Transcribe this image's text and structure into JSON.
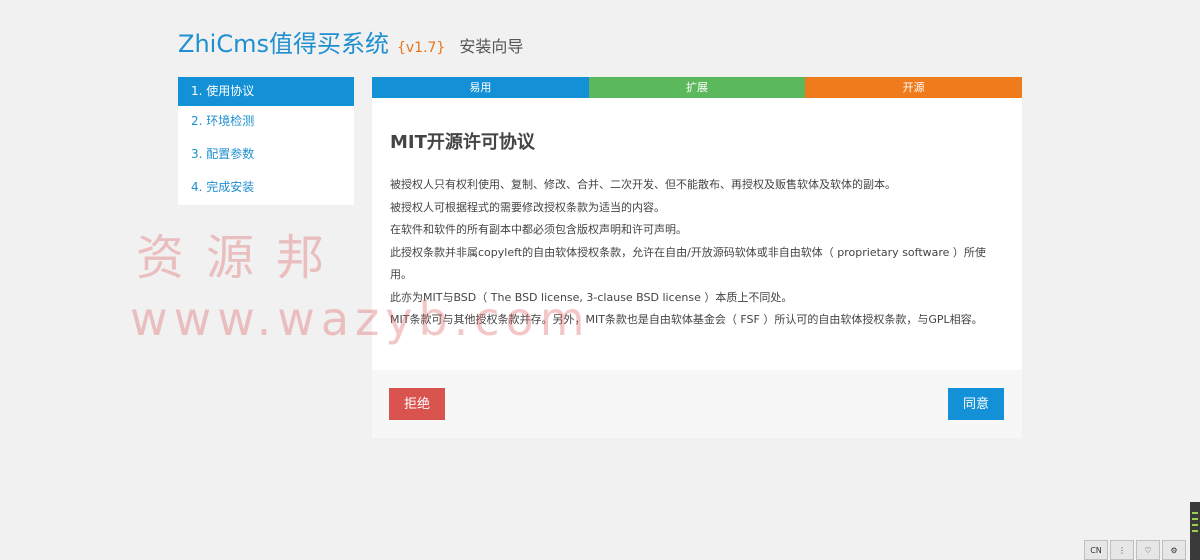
{
  "header": {
    "brand": "ZhiCms值得买系统",
    "version": "{v1.7}",
    "subtitle": "安装向导"
  },
  "sidebar": {
    "items": [
      {
        "label": "1. 使用协议",
        "active": true
      },
      {
        "label": "2. 环境检测",
        "active": false
      },
      {
        "label": "3. 配置参数",
        "active": false
      },
      {
        "label": "4. 完成安装",
        "active": false
      }
    ]
  },
  "strip": {
    "labels": [
      "易用",
      "扩展",
      "开源"
    ],
    "colors": [
      "#1490d6",
      "#5cb85c",
      "#f07b1c"
    ]
  },
  "license": {
    "title": "MIT开源许可协议",
    "paragraphs": [
      "被授权人只有权利使用、复制、修改、合并、二次开发、但不能散布、再授权及贩售软体及软体的副本。",
      "被授权人可根据程式的需要修改授权条款为适当的内容。",
      "在软件和软件的所有副本中都必须包含版权声明和许可声明。",
      "此授权条款并非属copyleft的自由软体授权条款，允许在自由/开放源码软体或非自由软体（ proprietary software ）所使用。",
      "此亦为MIT与BSD（ The BSD license, 3-clause BSD license ）本质上不同处。",
      "MIT条款可与其他授权条款并存。另外，MIT条款也是自由软体基金会（ FSF ）所认可的自由软体授权条款，与GPL相容。"
    ]
  },
  "buttons": {
    "reject": "拒绝",
    "agree": "同意"
  },
  "watermark": {
    "line1": "资源邦",
    "line2": "www.wazyb.com"
  },
  "taskbar": {
    "items": [
      {
        "icon": "keyboard-icon",
        "glyph": "CN"
      },
      {
        "icon": "more-icon",
        "glyph": "⋮"
      },
      {
        "icon": "heart-icon",
        "glyph": "♡"
      },
      {
        "icon": "gear-icon",
        "glyph": "⚙"
      }
    ]
  },
  "colors": {
    "accent": "#1490d6",
    "brand": "#1e8fd0",
    "version": "#e8751a",
    "reject": "#d9534f",
    "green": "#5cb85c",
    "orange": "#f07b1c"
  }
}
